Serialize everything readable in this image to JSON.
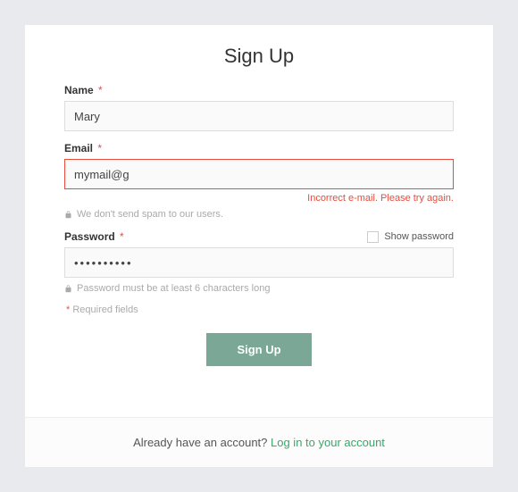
{
  "title": "Sign Up",
  "fields": {
    "name": {
      "label": "Name",
      "value": "Mary"
    },
    "email": {
      "label": "Email",
      "value": "mymail@g",
      "error": "Incorrect e-mail. Please try again.",
      "hint": "We don't send spam to our users."
    },
    "password": {
      "label": "Password",
      "value": "••••••••••",
      "hint": "Password must be at least 6 characters long",
      "show_label": "Show password"
    }
  },
  "required_note": "Required fields",
  "submit_label": "Sign Up",
  "footer": {
    "text": "Already have an account? ",
    "link": "Log in to your account"
  }
}
